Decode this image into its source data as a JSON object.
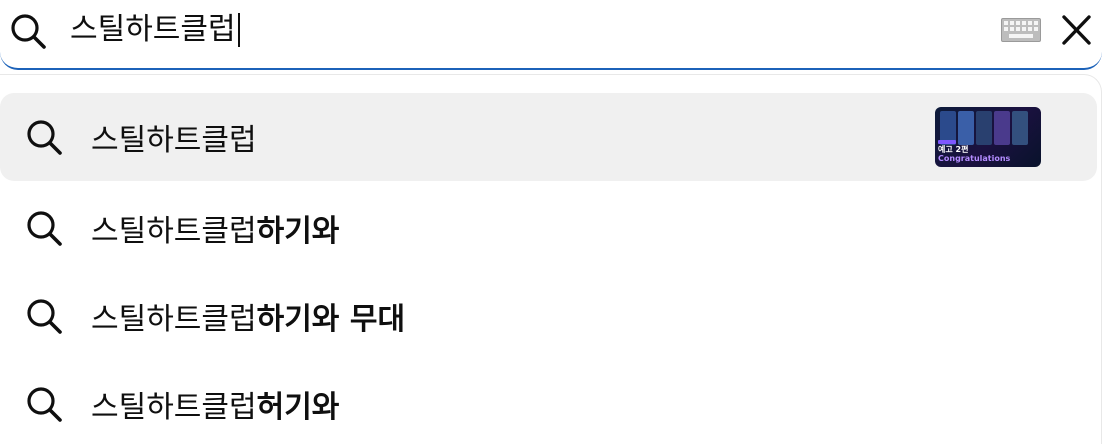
{
  "search": {
    "query": "스틸하트클럽"
  },
  "icons": {
    "search": "search-icon",
    "keyboard": "keyboard-icon",
    "close": "close-icon"
  },
  "suggestions": [
    {
      "prefix": "스틸하트클럽",
      "suffix": "",
      "highlighted": true,
      "thumbnail": {
        "line1": "예고 2편",
        "line2": "Congratulations"
      }
    },
    {
      "prefix": "스틸하트클럽",
      "suffix": "하기와"
    },
    {
      "prefix": "스틸하트클럽",
      "suffix": "하기와 무대"
    },
    {
      "prefix": "스틸하트클럽",
      "suffix": "허기와"
    }
  ],
  "colors": {
    "accent": "#1c62b9",
    "highlight_bg": "#f0f0f0",
    "text": "#0f0f0f",
    "thumb_purple": "#b48cff"
  }
}
